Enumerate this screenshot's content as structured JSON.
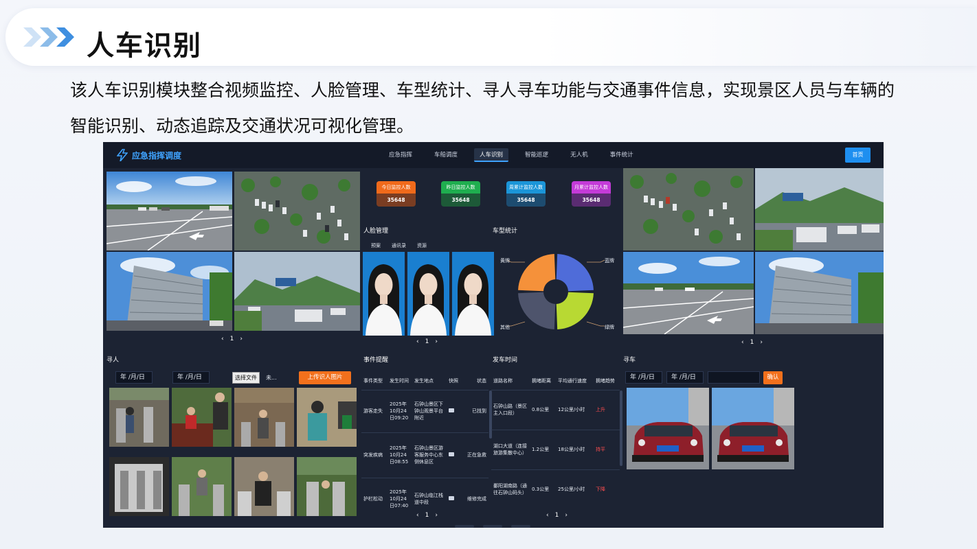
{
  "slide": {
    "title": "人车识别",
    "description": "该人车识别模块整合视频监控、人脸管理、车型统计、寻人寻车功能与交通事件信息，实现景区人员与车辆的智能识别、动态追踪及交通状况可视化管理。",
    "accent_color": "#3f8fe0"
  },
  "app": {
    "brand": "应急指挥调度",
    "nav": [
      "应急指挥",
      "车船调度",
      "人车识别",
      "智能巡逻",
      "无人机",
      "事件统计"
    ],
    "nav_active_index": 2,
    "home_button": "首页"
  },
  "stats": [
    {
      "label": "今日监控人数",
      "value": "35648",
      "color": "#f06a1b",
      "dark": "#7a3d22"
    },
    {
      "label": "昨日监控人数",
      "value": "35648",
      "color": "#1fae4f",
      "dark": "#1d5a38"
    },
    {
      "label": "周累计监控人数",
      "value": "35648",
      "color": "#1b95d8",
      "dark": "#1d4c70"
    },
    {
      "label": "月累计监控人数",
      "value": "35648",
      "color": "#c43bd8",
      "dark": "#5a2c72"
    }
  ],
  "pager": {
    "page": "1",
    "prev": "‹",
    "next": "›"
  },
  "face": {
    "title": "人脸管理",
    "tabs": [
      "预案",
      "通讯录",
      "资源"
    ]
  },
  "vehicle_stats": {
    "title": "车型统计",
    "chart_data": {
      "type": "pie",
      "labels": [
        "黄牌",
        "蓝牌",
        "绿牌",
        "其他"
      ],
      "values": [
        25,
        25,
        25,
        25
      ],
      "colors": [
        "#f5913a",
        "#4f6cd9",
        "#b8d933",
        "#4e546c"
      ]
    }
  },
  "find_person": {
    "title": "寻人",
    "date_placeholder": "年 /月/日",
    "file_button": "选择文件",
    "file_status": "未...",
    "upload_button": "上传识人图片"
  },
  "events": {
    "title": "事件提醒",
    "headers": [
      "事件类型",
      "发生时间",
      "发生地点",
      "快照",
      "状态"
    ],
    "rows": [
      {
        "type": "游客走失",
        "time": "2025年10月24日09:20",
        "place": "石钟山景区下钟山观景平台附近",
        "status": "已找到"
      },
      {
        "type": "突发疾病",
        "time": "2025年10月24日08:55",
        "place": "石钟山景区游客服务中心东侧休息区",
        "status": "正在急救"
      },
      {
        "type": "护栏松动",
        "time": "2025年10月24日07:40",
        "place": "石钟山临江栈道中段",
        "status": "维修完成"
      }
    ]
  },
  "departures": {
    "title": "发车时间",
    "headers": [
      "道路名称",
      "拥堵距离",
      "平均通行速度",
      "拥堵趋势"
    ],
    "rows": [
      {
        "road": "石钟山路（景区主入口段）",
        "dist": "0.8公里",
        "speed": "12公里/小时",
        "trend": "上升",
        "trend_color": "#ff4d4f"
      },
      {
        "road": "湖口大道（连接旅游集散中心）",
        "dist": "1.2公里",
        "speed": "18公里/小时",
        "trend": "持平",
        "trend_color": "#ff4d4f"
      },
      {
        "road": "鄱阳湖南路（通往石钟山码头）",
        "dist": "0.3公里",
        "speed": "25公里/小时",
        "trend": "下降",
        "trend_color": "#ff4d4f"
      }
    ]
  },
  "find_car": {
    "title": "寻车",
    "date_placeholder": "年 /月/日",
    "confirm_button": "确认"
  }
}
